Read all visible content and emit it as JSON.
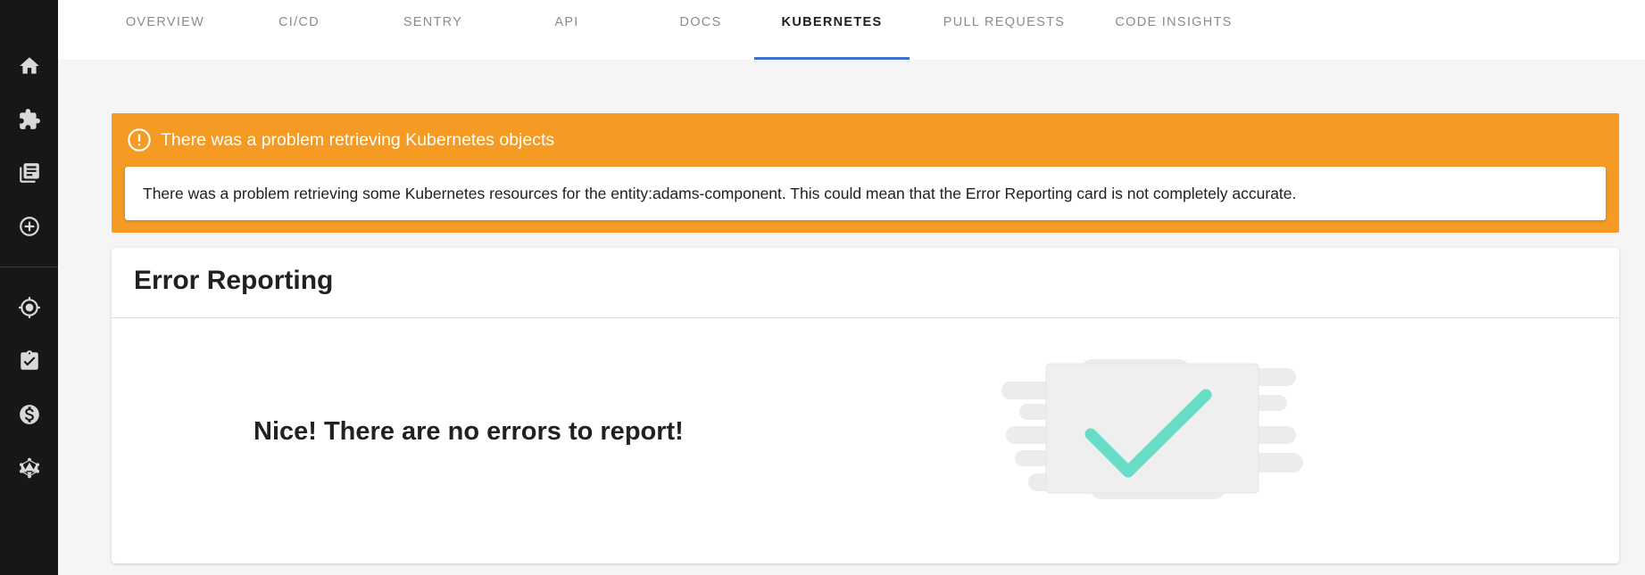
{
  "tabs": [
    {
      "label": "OVERVIEW"
    },
    {
      "label": "CI/CD"
    },
    {
      "label": "SENTRY"
    },
    {
      "label": "API"
    },
    {
      "label": "DOCS"
    },
    {
      "label": "KUBERNETES",
      "active": true
    },
    {
      "label": "PULL REQUESTS"
    },
    {
      "label": "CODE INSIGHTS"
    }
  ],
  "sidebar": {
    "icons": [
      "home-icon",
      "extension-icon",
      "library-books-icon",
      "add-circle-icon",
      "target-icon",
      "assignment-check-icon",
      "dollar-circle-icon",
      "graphql-icon"
    ]
  },
  "warning": {
    "title": "There was a problem retrieving Kubernetes objects",
    "message": "There was a problem retrieving some Kubernetes resources for the entity:adams-component. This could mean that the Error Reporting card is not completely accurate."
  },
  "card": {
    "title": "Error Reporting",
    "empty_message": "Nice! There are no errors to report!"
  },
  "colors": {
    "sidebar_bg": "#171717",
    "warning_bg": "#f59b23",
    "tab_indicator": "#3f6fcf",
    "check_color": "#67dcc6"
  }
}
